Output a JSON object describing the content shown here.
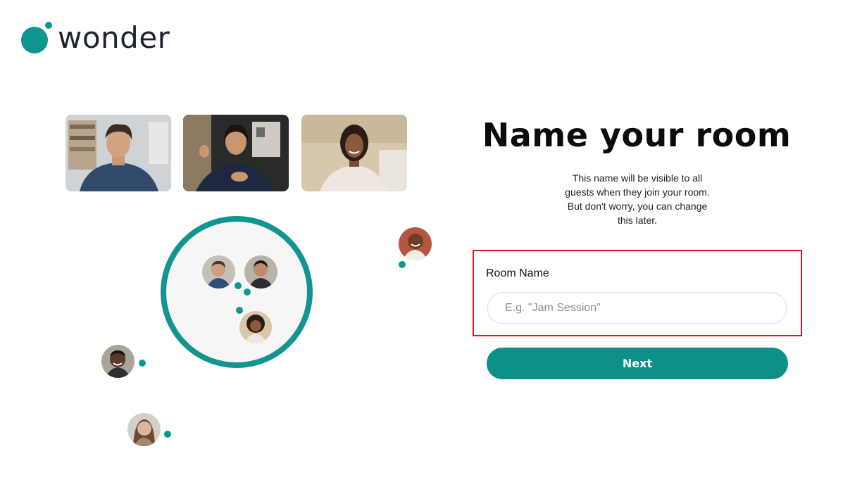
{
  "brand": {
    "name": "wonder",
    "accent": "#0e9590"
  },
  "page": {
    "title": "Name your room",
    "description_lines": [
      "This name will be visible to all",
      "guests when they join your room.",
      "But don't worry, you can change",
      "this later."
    ]
  },
  "form": {
    "label": "Room Name",
    "value": "",
    "placeholder": "E.g. \"Jam Session\"",
    "next_label": "Next"
  },
  "colors": {
    "highlight_box": "#e0141b",
    "button": "#0e8f8a"
  }
}
